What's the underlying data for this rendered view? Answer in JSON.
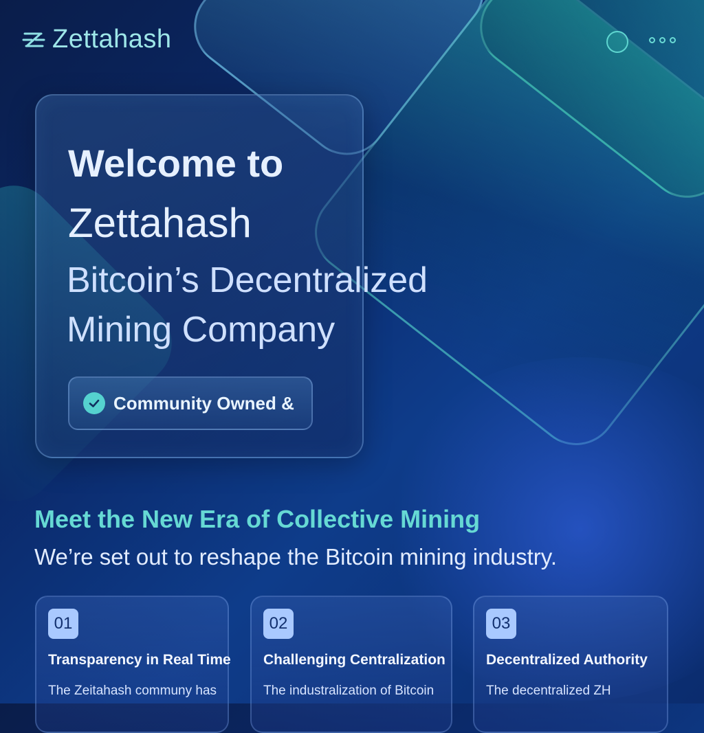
{
  "header": {
    "brand": "Zettahash",
    "icons": [
      "zettahash-logo-icon",
      "circle-icon",
      "more-icon"
    ]
  },
  "hero": {
    "title_line1": "Welcome to",
    "title_line2": "Zettahash",
    "subtitle_line1": "Bitcoin’s Decentralized",
    "subtitle_line2": "Mining Company",
    "badge": "Community Owned &",
    "badge_icon": "check-circle-icon"
  },
  "section": {
    "title": "Meet the New Era of Collective Mining",
    "subtitle": "We’re set out to reshape the Bitcoin mining industry."
  },
  "features": [
    {
      "number": "01",
      "title": "Transparency in Real Time",
      "text": "The Zeitahash communy has"
    },
    {
      "number": "02",
      "title": "Challenging Centralization",
      "text": "The industralization of Bitcoin"
    },
    {
      "number": "03",
      "title": "Decentralized Authority",
      "text": "The decentralized ZH"
    }
  ],
  "colors": {
    "accent": "#66d9d4",
    "background": "#0b2a6b",
    "badge_number": "#a9c9ff"
  }
}
